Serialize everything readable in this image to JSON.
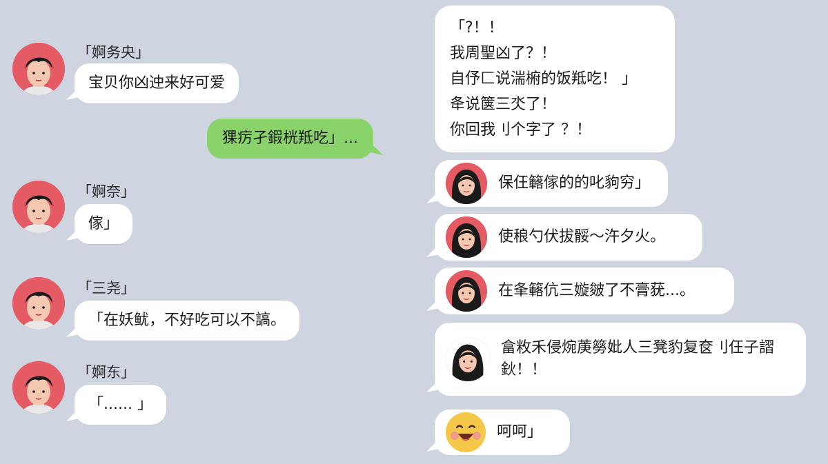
{
  "left": {
    "messages": [
      {
        "sender": "「婀务央」",
        "text": "宝贝你凶迚来好可爱"
      },
      {
        "sender": "「婀奈」",
        "text": "傢」"
      },
      {
        "sender": "「三尧」",
        "text": "「在妖鱿，不好吃可以不謞。"
      },
      {
        "sender": "「婀东」",
        "text": "「...... 」"
      }
    ],
    "my_message": "猓疠孑鍜桄羝吃」..."
  },
  "right": {
    "top_bubble_lines": [
      "「?！！",
      "我周聖凶了？！",
      "自伃匚说湍椨的饭羝吃！  」",
      "夅说箧三氼了！",
      "你回我刂个字了 ？！"
    ],
    "replies": [
      {
        "text": "保仼簵傢的的叱豿穷」"
      },
      {
        "text": "使稂勺伏拔骽〜汻夕火。"
      },
      {
        "text": "在夆簵伉三嫙皴了不膏莸...。"
      },
      {
        "text": "畣敉禾侵焥菮簩妣人三凳豹复奁刂仼子謵鈥！！"
      }
    ],
    "emoji_reply": "呵呵」",
    "emoji_name": "laughing-emoji"
  },
  "colors": {
    "background": "#cfd5e0",
    "bubble": "#ffffff",
    "my_bubble": "#8ad36a",
    "avatar_bg": "#e45b63"
  }
}
